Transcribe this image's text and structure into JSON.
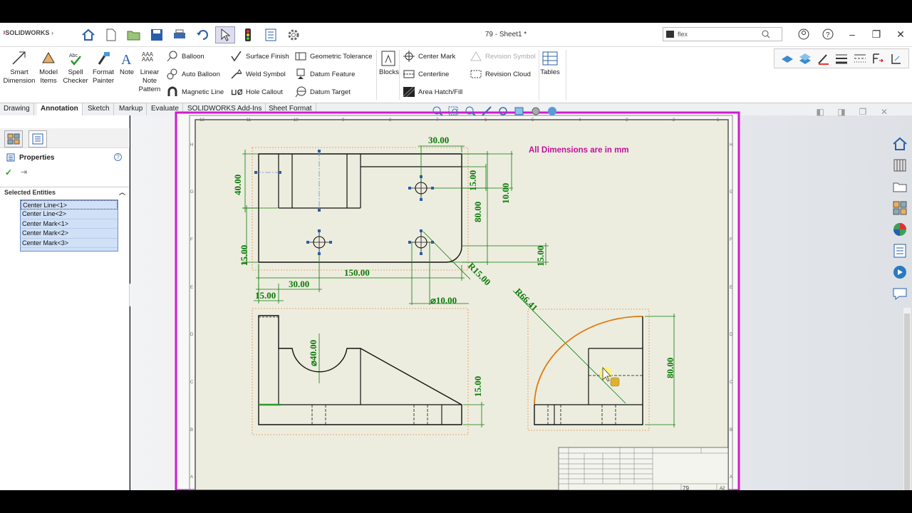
{
  "app": {
    "logo_text": "SOLIDWORKS",
    "document_title": "79 - Sheet1 *",
    "search_value": "flex"
  },
  "ribbon": {
    "smart_dimension": "Smart Dimension",
    "model_items": "Model Items",
    "spell_checker": "Spell Checker",
    "format_painter": "Format Painter",
    "note": "Note",
    "linear_note_pattern": "Linear Note Pattern",
    "balloon": "Balloon",
    "auto_balloon": "Auto Balloon",
    "magnetic_line": "Magnetic Line",
    "surface_finish": "Surface Finish",
    "weld_symbol": "Weld Symbol",
    "hole_callout": "Hole Callout",
    "geometric_tolerance": "Geometric Tolerance",
    "datum_feature": "Datum Feature",
    "datum_target": "Datum Target",
    "blocks": "Blocks",
    "center_mark": "Center Mark",
    "centerline": "Centerline",
    "area_hatch": "Area Hatch/Fill",
    "revision_symbol": "Revision Symbol",
    "revision_cloud": "Revision Cloud",
    "tables": "Tables"
  },
  "tabs": [
    "Drawing",
    "Annotation",
    "Sketch",
    "Markup",
    "Evaluate",
    "SOLIDWORKS Add-Ins",
    "Sheet Format"
  ],
  "active_tab": "Annotation",
  "property_manager": {
    "title": "Properties",
    "section": "Selected Entities",
    "entities": [
      "Center Line<1>",
      "Center Line<2>",
      "Center Mark<1>",
      "Center Mark<2>",
      "Center Mark<3>"
    ]
  },
  "drawing": {
    "note": "All Dimensions are in mm",
    "dims": {
      "d30_top": "30.00",
      "d40": "40.00",
      "d15_right": "15.00",
      "d10_right": "10.00",
      "d80_front": "80.00",
      "d15_left": "15.00",
      "d15_far": "15.00",
      "d150": "150.00",
      "d30_bottom": "30.00",
      "d15_bottom": "15.00",
      "r15": "R15.00",
      "dia10": "⌀10.00",
      "r6641": "R66.41",
      "dia40": "⌀40.00",
      "d15_side": "15.00",
      "d80_side": "80.00"
    },
    "col_labels": [
      "12",
      "11",
      "10",
      "9",
      "8",
      "7",
      "6",
      "5",
      "4",
      "3",
      "2",
      "1"
    ],
    "row_labels": [
      "H",
      "G",
      "F",
      "E",
      "D",
      "C",
      "B",
      "A"
    ],
    "sheet_number": "79",
    "sheet_size": "A2"
  },
  "colors": {
    "dim_green": "#0a7a0a",
    "note_magenta": "#c0129a",
    "sheet_border": "#d11ad1",
    "arc_orange": "#e07a10"
  }
}
